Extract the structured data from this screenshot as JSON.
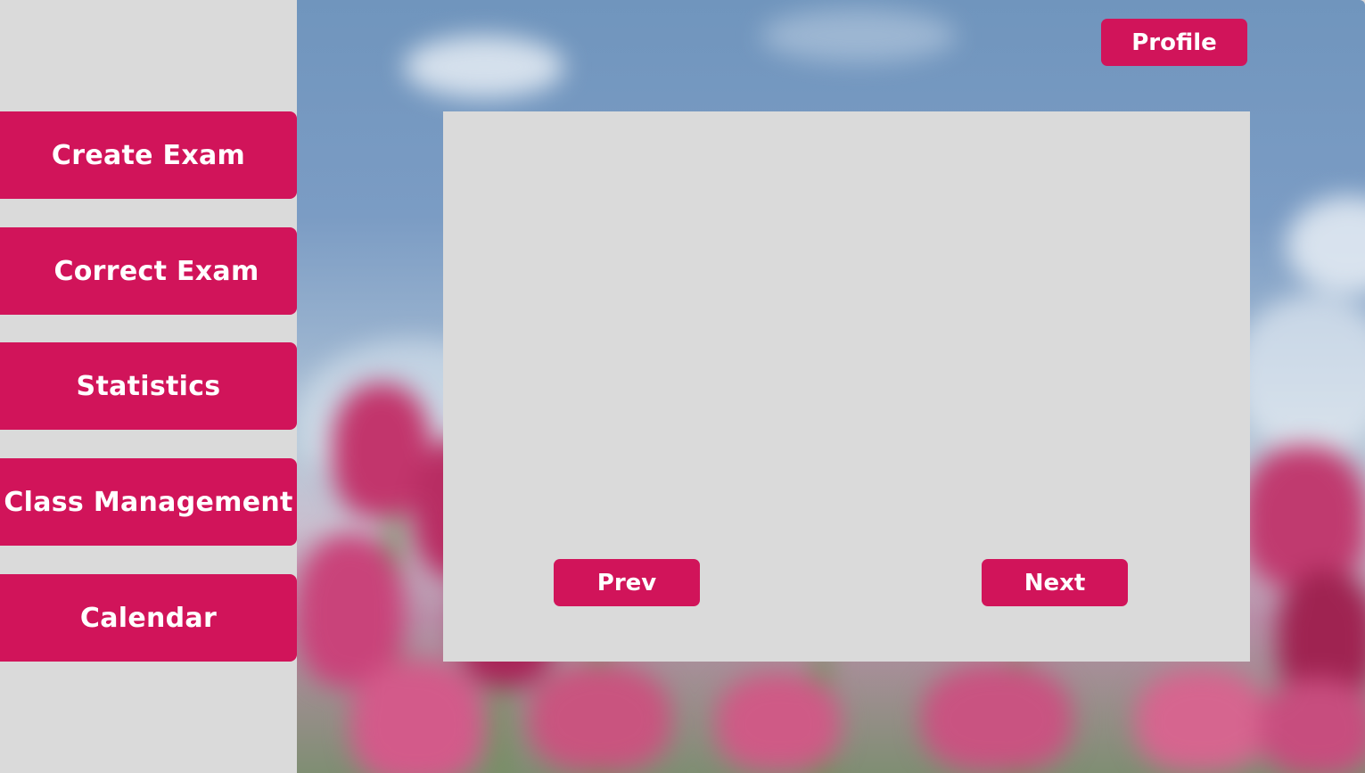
{
  "sidebar": {
    "items": [
      {
        "label": "Create Exam"
      },
      {
        "label": "Correct Exam"
      },
      {
        "label": "Statistics"
      },
      {
        "label": "Class Management"
      },
      {
        "label": "Calendar"
      }
    ]
  },
  "header": {
    "profile_label": "Profile"
  },
  "main": {
    "prev_label": "Prev",
    "next_label": "Next"
  },
  "colors": {
    "accent": "#d1145a",
    "panel": "#dadada"
  }
}
